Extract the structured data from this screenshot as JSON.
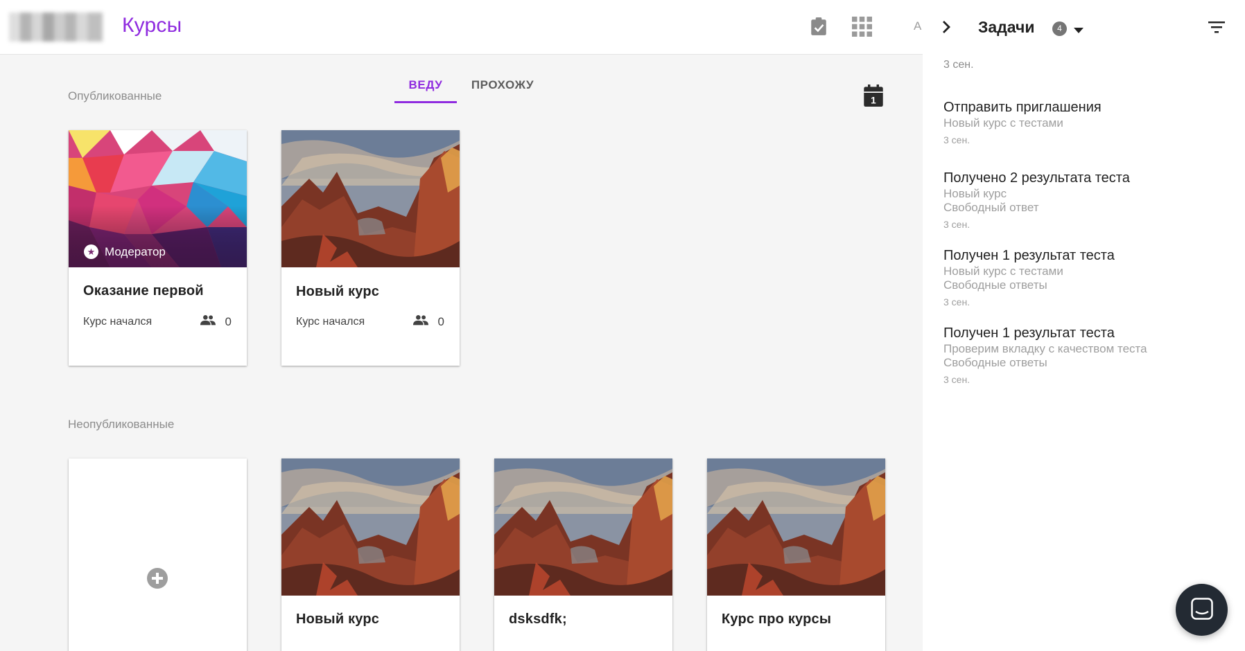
{
  "header": {
    "title": "Курсы",
    "avatar_letter": "A",
    "icons": [
      "tasks-check-icon",
      "apps-grid-icon"
    ]
  },
  "main": {
    "published_label": "Опубликованные",
    "unpublished_label": "Неопубликованные",
    "tabs": [
      {
        "label": "ВЕДУ",
        "active": true
      },
      {
        "label": "ПРОХОЖУ",
        "active": false
      }
    ],
    "calendar_day": "1",
    "published_courses": [
      {
        "title": "Оказание первой",
        "status": "Курс начался",
        "students": "0",
        "badge": "Модератор",
        "image": "polygon-art"
      },
      {
        "title": "Новый курс",
        "status": "Курс начался",
        "students": "0",
        "image": "canyon-photo"
      }
    ],
    "unpublished_courses": [
      {
        "title": "Новый курс",
        "image": "canyon-photo"
      },
      {
        "title": "dsksdfk;",
        "image": "canyon-photo"
      },
      {
        "title": "Курс про курсы",
        "image": "canyon-photo"
      }
    ]
  },
  "tasks_panel": {
    "title": "Задачи",
    "count": "4",
    "top_date": "3 сен.",
    "items": [
      {
        "title": "Отправить приглашения",
        "lines": [
          "Новый курс с тестами"
        ],
        "date": "3 сен."
      },
      {
        "title": "Получено 2 результата теста",
        "lines": [
          "Новый курс",
          "Свободный ответ"
        ],
        "date": "3 сен."
      },
      {
        "title": "Получен 1 результат теста",
        "lines": [
          "Новый курс с тестами",
          "Свободные ответы"
        ],
        "date": "3 сен."
      },
      {
        "title": "Получен 1 результат теста",
        "lines": [
          "Проверим вкладку с качеством теста",
          "Свободные ответы"
        ],
        "date": "3 сен."
      }
    ]
  },
  "colors": {
    "accent": "#8f2bdf",
    "background": "#f5f5f5",
    "muted_text": "#9e9e9e",
    "fab": "#232a33"
  }
}
